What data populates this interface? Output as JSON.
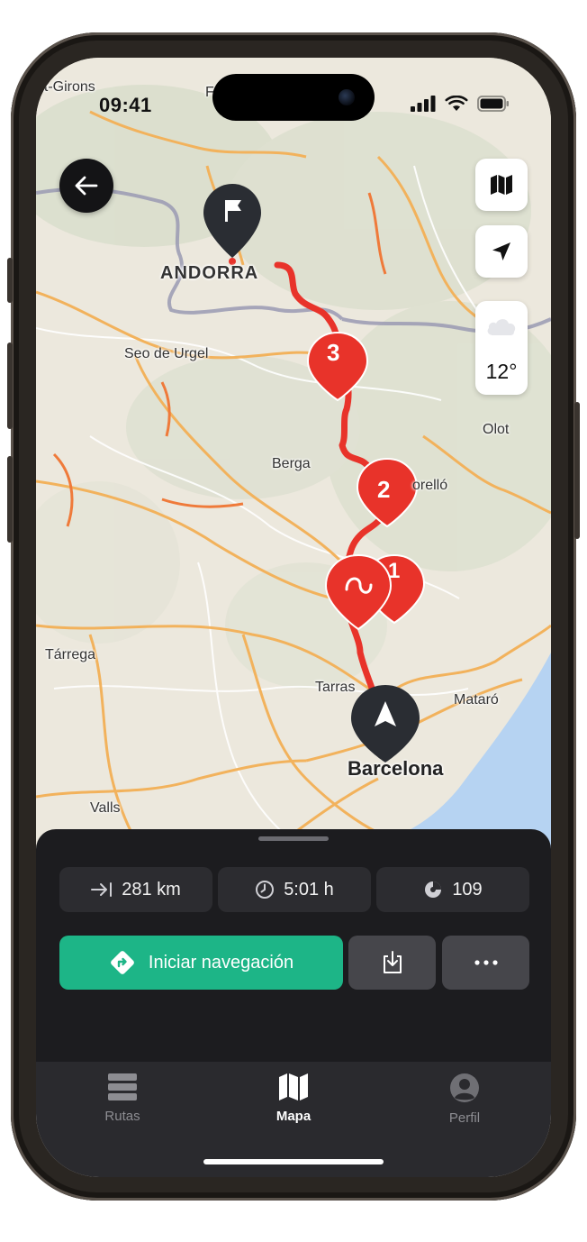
{
  "status_bar": {
    "time": "09:41"
  },
  "map": {
    "labels": {
      "saint_girons": "nt-Girons",
      "andorra": "ANDORRA",
      "seo_de_urgel": "Seo de Urgel",
      "berga": "Berga",
      "olot": "Olot",
      "torello": "orelló",
      "tarrega": "Tárrega",
      "terrassa": "Tarras",
      "mataro": "Mataró",
      "barcelona": "Barcelona",
      "valls": "Valls",
      "top_cut": "F"
    },
    "waypoints": [
      "1",
      "2",
      "3"
    ],
    "weather": {
      "icon": "cloud-icon",
      "temperature": "12°"
    }
  },
  "route_summary": {
    "distance": "281 km",
    "duration": "5:01 h",
    "curviness": "109"
  },
  "actions": {
    "start_navigation": "Iniciar navegación"
  },
  "tabbar": {
    "items": [
      {
        "label": "Rutas",
        "icon": "routes-icon"
      },
      {
        "label": "Mapa",
        "icon": "map-icon"
      },
      {
        "label": "Perfil",
        "icon": "profile-icon"
      }
    ],
    "active_index": 1
  },
  "colors": {
    "route": "#e8332a",
    "accent_green": "#1db587",
    "sheet_bg": "#1c1c1f",
    "sea": "#b6d3f2"
  }
}
